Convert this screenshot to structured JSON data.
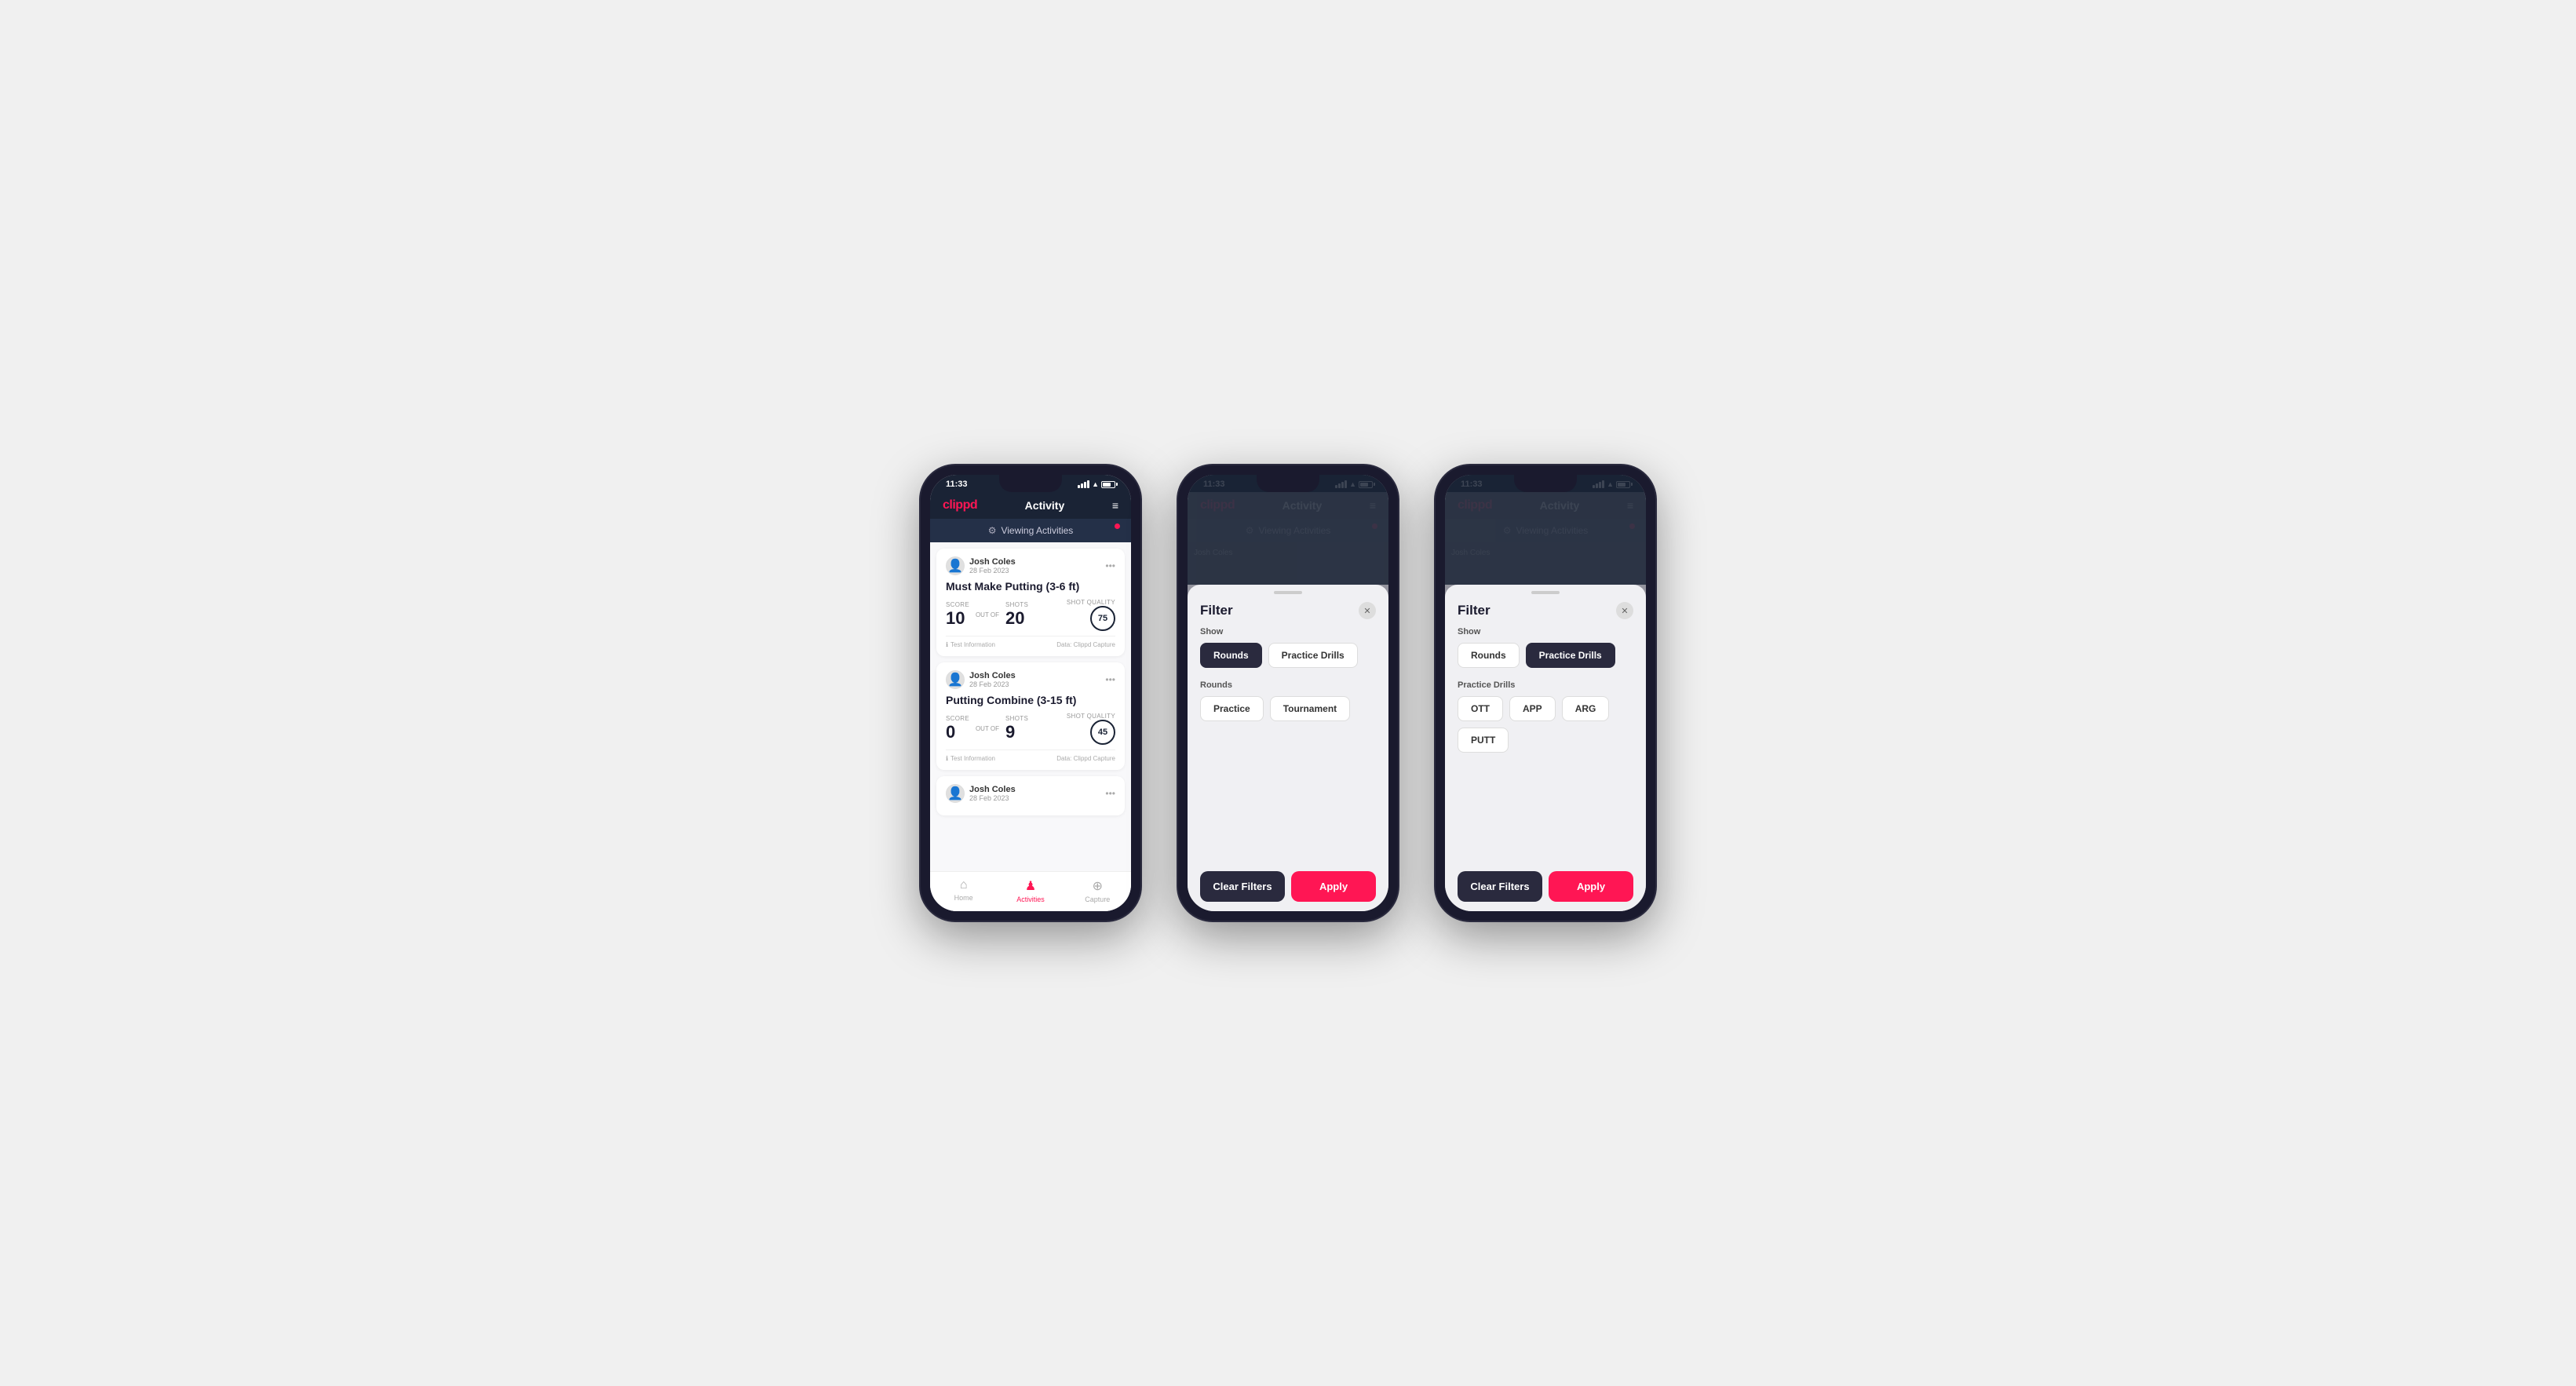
{
  "statusBar": {
    "time": "11:33",
    "batteryLevel": 51
  },
  "header": {
    "logo": "clippd",
    "title": "Activity",
    "menuLabel": "≡"
  },
  "viewingBar": {
    "text": "Viewing Activities"
  },
  "phone1": {
    "cards": [
      {
        "userName": "Josh Coles",
        "userDate": "28 Feb 2023",
        "title": "Must Make Putting (3-6 ft)",
        "scoreLabelCard": "Score",
        "shotslabel": "Shots",
        "shotQualityLabel": "Shot Quality",
        "scoreValue": "10",
        "outOfLabel": "OUT OF",
        "shotsValue": "20",
        "shotQualityValue": "75",
        "testInfo": "Test Information",
        "dataSource": "Data: Clippd Capture"
      },
      {
        "userName": "Josh Coles",
        "userDate": "28 Feb 2023",
        "title": "Putting Combine (3-15 ft)",
        "scoreLabelCard": "Score",
        "shotslabel": "Shots",
        "shotQualityLabel": "Shot Quality",
        "scoreValue": "0",
        "outOfLabel": "OUT OF",
        "shotsValue": "9",
        "shotQualityValue": "45",
        "testInfo": "Test Information",
        "dataSource": "Data: Clippd Capture"
      },
      {
        "userName": "Josh Coles",
        "userDate": "28 Feb 2023",
        "title": "",
        "partial": true
      }
    ],
    "nav": {
      "home": "Home",
      "activities": "Activities",
      "capture": "Capture"
    }
  },
  "phone2": {
    "filter": {
      "title": "Filter",
      "showLabel": "Show",
      "roundsBtn": "Rounds",
      "practiceBtn": "Practice Drills",
      "roundsLabel": "Rounds",
      "practiceBtn1": "Practice",
      "tournamentBtn": "Tournament",
      "clearLabel": "Clear Filters",
      "applyLabel": "Apply",
      "activeSection": "rounds"
    }
  },
  "phone3": {
    "filter": {
      "title": "Filter",
      "showLabel": "Show",
      "roundsBtn": "Rounds",
      "practiceBtn": "Practice Drills",
      "practiceDrillsLabel": "Practice Drills",
      "ottBtn": "OTT",
      "appBtn": "APP",
      "argBtn": "ARG",
      "puttBtn": "PUTT",
      "clearLabel": "Clear Filters",
      "applyLabel": "Apply",
      "activeSection": "practice"
    }
  }
}
